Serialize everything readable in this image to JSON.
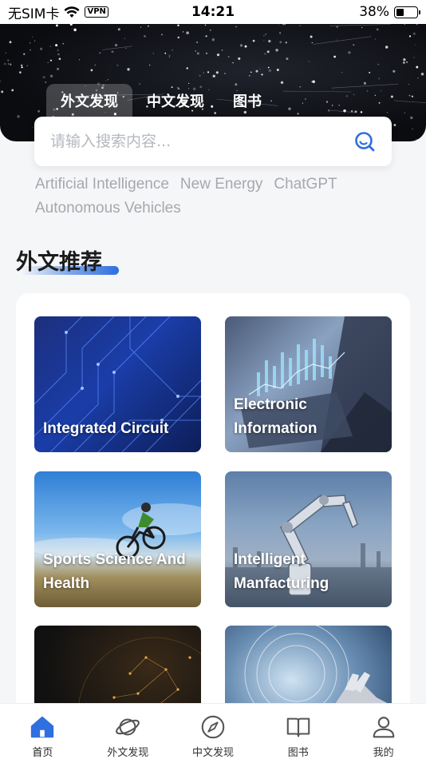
{
  "status_bar": {
    "carrier": "无SIM卡",
    "vpn": "VPN",
    "time": "14:21",
    "battery_text": "38%",
    "battery_level": 0.38
  },
  "hero": {
    "tabs": [
      {
        "label": "外文发现",
        "active": true
      },
      {
        "label": "中文发现",
        "active": false
      },
      {
        "label": "图书",
        "active": false
      }
    ]
  },
  "search": {
    "placeholder": "请输入搜索内容...",
    "icon": "search-icon"
  },
  "hot_tags": [
    "Artificial Intelligence",
    "New Energy",
    "ChatGPT",
    "Autonomous Vehicles"
  ],
  "section": {
    "title": "外文推荐"
  },
  "categories": [
    {
      "label": "Integrated Circuit"
    },
    {
      "label": "Electronic Information"
    },
    {
      "label": "Sports Science And Health"
    },
    {
      "label": "Intelligent Manfacturing"
    },
    {
      "label": ""
    },
    {
      "label": ""
    }
  ],
  "tab_bar": {
    "items": [
      {
        "label": "首页",
        "icon": "home-icon",
        "active": true
      },
      {
        "label": "外文发现",
        "icon": "planet-icon",
        "active": false
      },
      {
        "label": "中文发现",
        "icon": "compass-icon",
        "active": false
      },
      {
        "label": "图书",
        "icon": "book-icon",
        "active": false
      },
      {
        "label": "我的",
        "icon": "user-icon",
        "active": false
      }
    ]
  },
  "colors": {
    "accent": "#2f6fe0",
    "tab_icon": "#555555"
  }
}
